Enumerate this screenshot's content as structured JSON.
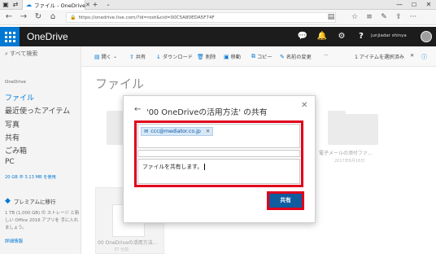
{
  "browser": {
    "tab_title": "ファイル - OneDrive",
    "url": "https://onedrive.live.com/?id=root&cid=00C5A80EDA5F74F",
    "new_tab_label": "+"
  },
  "app": {
    "brand": "OneDrive",
    "user_name": "junjiadar shinya"
  },
  "leftnav": {
    "search_placeholder": "すべて検索",
    "section_label": "OneDrive",
    "items": [
      "ファイル",
      "最近使ったアイテム",
      "写真",
      "共有",
      "ごみ箱",
      "PC"
    ],
    "storage": "20 GB 中 3.13 MB を使用",
    "premium_title": "プレミアムに移行",
    "premium_desc": "1 TB (1,000 GB) の ストレージ と新しい Office 2016 アプリを 手に入れましょう。",
    "premium_link": "詳細情報"
  },
  "commands": {
    "open": "開く",
    "share": "共有",
    "download": "ダウンロード",
    "delete": "削除",
    "move": "移動",
    "copy": "コピー",
    "rename": "名前の変更",
    "more": "···",
    "selection_status": "1 アイテムを選択済み"
  },
  "content": {
    "page_title": "ファイル",
    "folder_name": "電子メールの添付ファ...",
    "folder_date": "2017年6月16日",
    "file_name": "00 OneDriveの活用方法...",
    "file_size": "37 分前"
  },
  "dialog": {
    "title": "'00 OneDriveの活用方法' の共有",
    "recipient": "ccc@mediator.co.jp",
    "message": "ファイルを共有します。",
    "share_button": "共有"
  },
  "colors": {
    "accent": "#0078d4",
    "highlight": "#e0001b",
    "share_button": "#0f5c9f"
  }
}
